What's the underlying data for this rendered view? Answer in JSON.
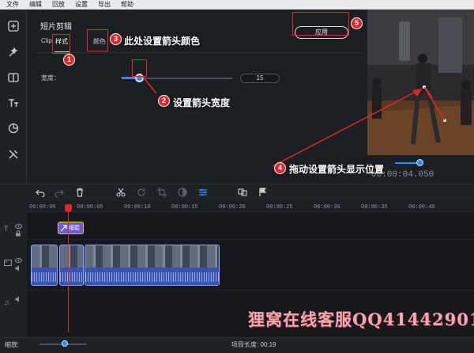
{
  "menu": [
    "文件",
    "编辑",
    "回放",
    "设置",
    "导出",
    "帮助"
  ],
  "edit_panel": {
    "title": "短片剪辑",
    "tabs": [
      {
        "label": "Clip",
        "active": false
      },
      {
        "label": "样式",
        "active": true
      },
      {
        "label": "颜色",
        "active": false
      }
    ],
    "width_label": "宽度：",
    "width_value": "15",
    "width_fraction": 0.14,
    "apply_label": "应用"
  },
  "preview": {
    "timecode": "00:00:04.050",
    "scrub_fraction": 0.9
  },
  "timeline": {
    "ruler_ticks": [
      "00:00:00",
      "00:00:05",
      "00:00:10",
      "00:00:15",
      "00:00:20",
      "00:00:25",
      "00:00:30",
      "00:00:35",
      "00:00:40"
    ],
    "title_clip_label": "细箭"
  },
  "bottom": {
    "zoom_label": "缩放:",
    "zoom_fraction": 0.55,
    "project_length": "项目长度: 00:19"
  },
  "annotations": {
    "a1": "1",
    "a2": "2",
    "a2_text": "设置箭头宽度",
    "a3": "3",
    "a3_text": "此处设置箭头颜色",
    "a4": "4",
    "a4_text": "拖动设置箭头显示位置",
    "a5": "5"
  },
  "watermark": "狸窝在线客服QQ41442901",
  "colors": {
    "accent": "#2d8cf0",
    "annotation_red": "#e0262b",
    "title_clip": "#6b5bd6"
  }
}
